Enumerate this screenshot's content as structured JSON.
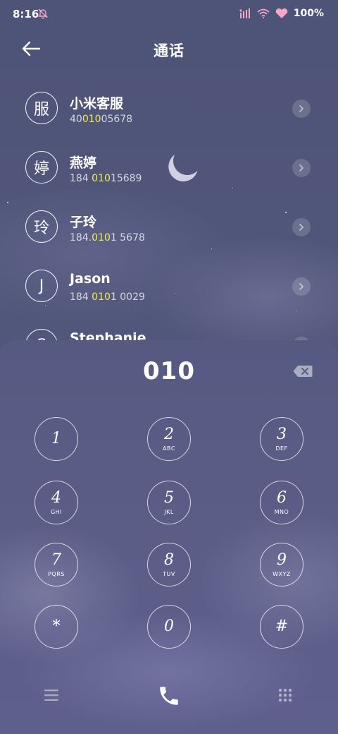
{
  "status_bar": {
    "time": "8:16",
    "battery": "100%"
  },
  "header": {
    "title": "通话"
  },
  "contacts": [
    {
      "avatar": "服",
      "name": "小米客服",
      "num_pre": "40",
      "num_match": "010",
      "num_post": "05678"
    },
    {
      "avatar": "婷",
      "name": "燕婷",
      "num_pre": "184 ",
      "num_match": "010",
      "num_post": "15689"
    },
    {
      "avatar": "玲",
      "name": "子玲",
      "num_pre": "184.",
      "num_match": "010",
      "num_post": "1 5678"
    },
    {
      "avatar": "J",
      "name": "Jason",
      "num_pre": "184 ",
      "num_match": "010",
      "num_post": "1 0029"
    },
    {
      "avatar": "S",
      "name": "Stephanie",
      "num_pre": "",
      "num_match": "",
      "num_post": ""
    }
  ],
  "dialer": {
    "input": "010",
    "keys": [
      {
        "num": "1",
        "letters": ""
      },
      {
        "num": "2",
        "letters": "ABC"
      },
      {
        "num": "3",
        "letters": "DEF"
      },
      {
        "num": "4",
        "letters": "GHI"
      },
      {
        "num": "5",
        "letters": "JKL"
      },
      {
        "num": "6",
        "letters": "MNO"
      },
      {
        "num": "7",
        "letters": "PQRS"
      },
      {
        "num": "8",
        "letters": "TUV"
      },
      {
        "num": "9",
        "letters": "WXYZ"
      },
      {
        "num": "*",
        "letters": ""
      },
      {
        "num": "0",
        "letters": ""
      },
      {
        "num": "#",
        "letters": ""
      }
    ]
  },
  "colors": {
    "match_highlight": "#f4ec55",
    "background": "#4f5479"
  }
}
